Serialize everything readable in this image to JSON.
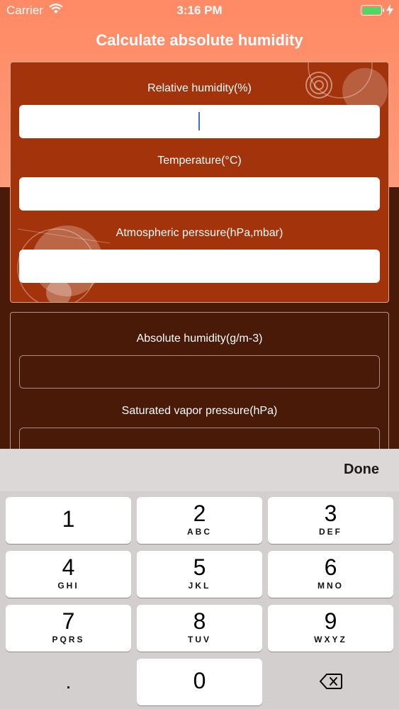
{
  "status_bar": {
    "carrier": "Carrier",
    "time": "3:16 PM"
  },
  "title": "Calculate absolute humidity",
  "inputs": [
    {
      "label": "Relative humidity(%)",
      "value": ""
    },
    {
      "label": "Temperature(°C)",
      "value": ""
    },
    {
      "label": "Atmospheric perssure(hPa,mbar)",
      "value": ""
    }
  ],
  "outputs": [
    {
      "label": "Absolute humidity(g/m-3)",
      "value": ""
    },
    {
      "label": "Saturated vapor pressure(hPa)",
      "value": ""
    }
  ],
  "keyboard": {
    "done_label": "Done",
    "keys": [
      {
        "digit": "1",
        "letters": ""
      },
      {
        "digit": "2",
        "letters": "ABC"
      },
      {
        "digit": "3",
        "letters": "DEF"
      },
      {
        "digit": "4",
        "letters": "GHI"
      },
      {
        "digit": "5",
        "letters": "JKL"
      },
      {
        "digit": "6",
        "letters": "MNO"
      },
      {
        "digit": "7",
        "letters": "PQRS"
      },
      {
        "digit": "8",
        "letters": "TUV"
      },
      {
        "digit": "9",
        "letters": "WXYZ"
      },
      {
        "digit": "0",
        "letters": ""
      }
    ],
    "decimal_label": "."
  },
  "colors": {
    "header_bg": "#ff8a65",
    "input_card_bg": "#a3330a",
    "dark_bg": "#491a08",
    "caret": "#3b6fdc",
    "battery": "#4cd964"
  }
}
